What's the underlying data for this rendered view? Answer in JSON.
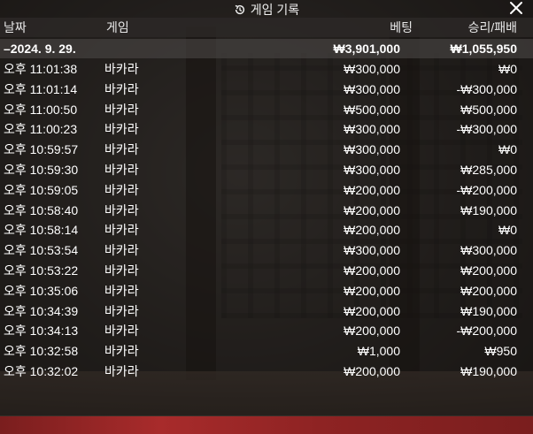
{
  "window": {
    "title": "게임 기록",
    "close_icon": "close-icon"
  },
  "columns": {
    "date": "날짜",
    "game": "게임",
    "bet": "베팅",
    "result": "승리/패배"
  },
  "summary": {
    "date": "–2024. 9. 29.",
    "bet": "₩3,901,000",
    "result": "₩1,055,950"
  },
  "rows": [
    {
      "time": "오후 11:01:38",
      "game": "바카라",
      "bet": "₩300,000",
      "result": "₩0"
    },
    {
      "time": "오후 11:01:14",
      "game": "바카라",
      "bet": "₩300,000",
      "result": "-₩300,000"
    },
    {
      "time": "오후 11:00:50",
      "game": "바카라",
      "bet": "₩500,000",
      "result": "₩500,000"
    },
    {
      "time": "오후 11:00:23",
      "game": "바카라",
      "bet": "₩300,000",
      "result": "-₩300,000"
    },
    {
      "time": "오후 10:59:57",
      "game": "바카라",
      "bet": "₩300,000",
      "result": "₩0"
    },
    {
      "time": "오후 10:59:30",
      "game": "바카라",
      "bet": "₩300,000",
      "result": "₩285,000"
    },
    {
      "time": "오후 10:59:05",
      "game": "바카라",
      "bet": "₩200,000",
      "result": "-₩200,000"
    },
    {
      "time": "오후 10:58:40",
      "game": "바카라",
      "bet": "₩200,000",
      "result": "₩190,000"
    },
    {
      "time": "오후 10:58:14",
      "game": "바카라",
      "bet": "₩200,000",
      "result": "₩0"
    },
    {
      "time": "오후 10:53:54",
      "game": "바카라",
      "bet": "₩300,000",
      "result": "₩300,000"
    },
    {
      "time": "오후 10:53:22",
      "game": "바카라",
      "bet": "₩200,000",
      "result": "₩200,000"
    },
    {
      "time": "오후 10:35:06",
      "game": "바카라",
      "bet": "₩200,000",
      "result": "₩200,000"
    },
    {
      "time": "오후 10:34:39",
      "game": "바카라",
      "bet": "₩200,000",
      "result": "₩190,000"
    },
    {
      "time": "오후 10:34:13",
      "game": "바카라",
      "bet": "₩200,000",
      "result": "-₩200,000"
    },
    {
      "time": "오후 10:32:58",
      "game": "바카라",
      "bet": "₩1,000",
      "result": "₩950"
    },
    {
      "time": "오후 10:32:02",
      "game": "바카라",
      "bet": "₩200,000",
      "result": "₩190,000"
    }
  ]
}
